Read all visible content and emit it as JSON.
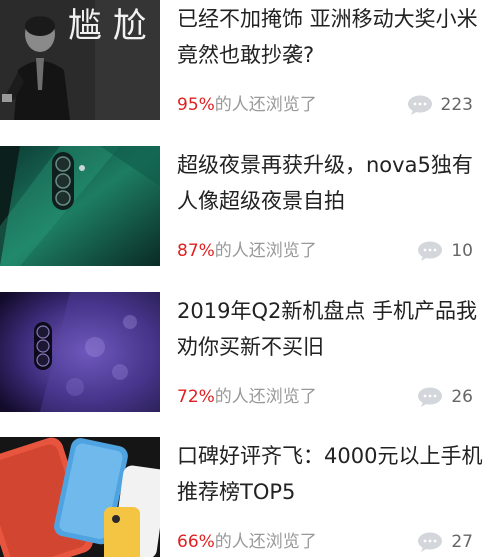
{
  "feed": {
    "items": [
      {
        "title": "已经不加掩饰 亚洲移动大奖小米竟然也敢抄袭?",
        "percent": "95%",
        "viewed_label": "的人还浏览了",
        "comment_count": "223",
        "thumb_text": "尴 尬"
      },
      {
        "title": "超级夜景再获升级，nova5独有人像超级夜景自拍",
        "percent": "87%",
        "viewed_label": "的人还浏览了",
        "comment_count": "10"
      },
      {
        "title": "2019年Q2新机盘点 手机产品我劝你买新不买旧",
        "percent": "72%",
        "viewed_label": "的人还浏览了",
        "comment_count": "26"
      },
      {
        "title": "口碑好评齐飞：4000元以上手机推荐榜TOP5",
        "percent": "66%",
        "viewed_label": "的人还浏览了",
        "comment_count": "27"
      }
    ]
  },
  "icons": {
    "comment": "comment-bubble-icon"
  },
  "colors": {
    "percent": "#e02020",
    "meta_text": "#999999",
    "title_text": "#222222",
    "comment_icon": "#d3d6db"
  }
}
